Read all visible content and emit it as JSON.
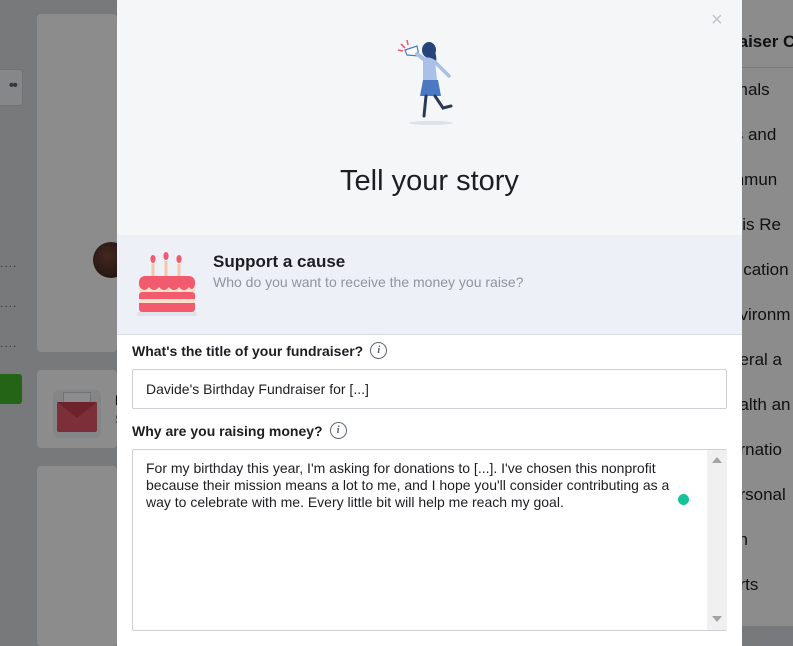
{
  "background": {
    "more_glyph": "••",
    "bg_letter": "I",
    "bg_letter2": "S",
    "right_panel": {
      "heading": "raiser C",
      "items": [
        "imals",
        "ts and",
        "mmun",
        "isis Re",
        "lucation",
        "nvironm",
        "neral a",
        "ealth an",
        "ernatio",
        "ersonal",
        "ith",
        "orts"
      ]
    }
  },
  "modal": {
    "close_glyph": "×",
    "title": "Tell your story",
    "cause": {
      "title": "Support a cause",
      "subtitle": "Who do you want to receive the money you raise?"
    },
    "fundraiser_title": {
      "label": "What's the title of your fundraiser?",
      "value": "Davide's Birthday Fundraiser for [...]"
    },
    "reason": {
      "label": "Why are you raising money?",
      "value": "For my birthday this year, I'm asking for donations to [...]. I've chosen this nonprofit because their mission means a lot to me, and I hope you'll consider contributing as a way to celebrate with me. Every little bit will help me reach my goal."
    },
    "info_glyph": "i"
  },
  "colors": {
    "accent_dot": "#15c39a",
    "cause_band": "#edf0f7",
    "hero_bg": "#f5f6f7",
    "illustration_blue": "#4a78c2",
    "cake_pink": "#f25a6e"
  }
}
